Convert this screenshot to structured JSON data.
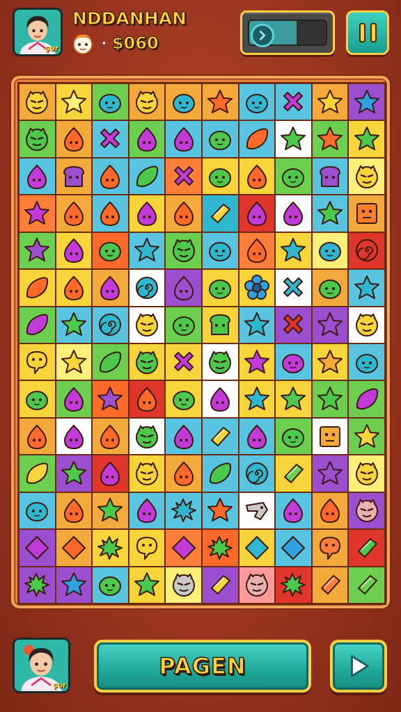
{
  "header": {
    "player_name": "NDDANHAN",
    "coins": "$060",
    "separator": "·",
    "avatar_tag": "ʂᴜr",
    "progress": 0.62
  },
  "footer": {
    "main_button_label": "PAGEN",
    "avatar_tag": "ʂᴜr"
  },
  "board": {
    "rows": [
      [
        [
          "face",
          "#f6d43a",
          "#f4a93b"
        ],
        [
          "star",
          "#fff07a",
          "#f6d43a"
        ],
        [
          "blob",
          "#2fb7d0",
          "#6ccf4f"
        ],
        [
          "face",
          "#f6d43a",
          "#f4a93b"
        ],
        [
          "blob",
          "#2fb7d0",
          "#f4a93b"
        ],
        [
          "star",
          "#ff6a2a",
          "#f4a93b"
        ],
        [
          "blob",
          "#2fb7d0",
          "#58c4e0"
        ],
        [
          "cross",
          "#c23bd8",
          "#58c4e0"
        ],
        [
          "star",
          "#f6d43a",
          "#f4a93b"
        ],
        [
          "star",
          "#2fa0e0",
          "#9b4fcf"
        ]
      ],
      [
        [
          "face",
          "#4cc94c",
          "#6ccf4f"
        ],
        [
          "drop",
          "#ff6a2a",
          "#f4a93b"
        ],
        [
          "cross",
          "#c23bd8",
          "#58c4e0"
        ],
        [
          "drop",
          "#c23bd8",
          "#6ccf4f"
        ],
        [
          "drop",
          "#c23bd8",
          "#58c4e0"
        ],
        [
          "blob",
          "#4cc94c",
          "#58c4e0"
        ],
        [
          "leaf",
          "#ff6a2a",
          "#58c4e0"
        ],
        [
          "star",
          "#4cc94c",
          "#ffffff"
        ],
        [
          "star",
          "#ff6a2a",
          "#6ccf4f"
        ],
        [
          "star",
          "#4cc94c",
          "#f6d43a"
        ]
      ],
      [
        [
          "drop",
          "#c23bd8",
          "#58c4e0"
        ],
        [
          "bread",
          "#9b4fcf",
          "#f4a93b"
        ],
        [
          "drop",
          "#ff6a2a",
          "#58c4e0"
        ],
        [
          "leaf",
          "#4cc94c",
          "#58c4e0"
        ],
        [
          "cross",
          "#c23bd8",
          "#ff7e3a"
        ],
        [
          "blob",
          "#4cc94c",
          "#f6d43a"
        ],
        [
          "drop",
          "#ff6a2a",
          "#f6d43a"
        ],
        [
          "blob",
          "#4cc94c",
          "#6ccf4f"
        ],
        [
          "bread",
          "#9b4fcf",
          "#58c4e0"
        ],
        [
          "face",
          "#f6d43a",
          "#fff07a"
        ]
      ],
      [
        [
          "star",
          "#c23bd8",
          "#ff7e3a"
        ],
        [
          "drop",
          "#ff6a2a",
          "#f4a93b"
        ],
        [
          "drop",
          "#ff6a2a",
          "#58c4e0"
        ],
        [
          "drop",
          "#c23bd8",
          "#f6d43a"
        ],
        [
          "drop",
          "#ff6a2a",
          "#f4a93b"
        ],
        [
          "gem",
          "#f6d43a",
          "#2fb7d0"
        ],
        [
          "drop",
          "#c23bd8",
          "#e0352a"
        ],
        [
          "drop",
          "#c23bd8",
          "#ffffff"
        ],
        [
          "star",
          "#4cc94c",
          "#58c4e0"
        ],
        [
          "box",
          "#ff7e2a",
          "#f4a93b"
        ]
      ],
      [
        [
          "star",
          "#9b4fcf",
          "#6ccf4f"
        ],
        [
          "drop",
          "#c23bd8",
          "#f6d43a"
        ],
        [
          "blob",
          "#4cc94c",
          "#ff6a2a"
        ],
        [
          "star",
          "#2fb7d0",
          "#58c4e0"
        ],
        [
          "face",
          "#4cc94c",
          "#6ccf4f"
        ],
        [
          "blob",
          "#2fb7d0",
          "#58c4e0"
        ],
        [
          "drop",
          "#ff6a2a",
          "#ff7e3a"
        ],
        [
          "star",
          "#2fb7d0",
          "#f6d43a"
        ],
        [
          "blob",
          "#2fb7d0",
          "#fff07a"
        ],
        [
          "swirl",
          "#e0352a",
          "#e0352a"
        ]
      ],
      [
        [
          "leaf",
          "#ff6a2a",
          "#f6d43a"
        ],
        [
          "drop",
          "#ff6a2a",
          "#f6d43a"
        ],
        [
          "drop",
          "#c23bd8",
          "#f4a93b"
        ],
        [
          "swirl",
          "#2fb7d0",
          "#ffffff"
        ],
        [
          "drop",
          "#9b4fcf",
          "#9b4fcf"
        ],
        [
          "blob",
          "#4cc94c",
          "#f6d43a"
        ],
        [
          "flower",
          "#2fa0e0",
          "#f6d43a"
        ],
        [
          "cross",
          "#2fb7d0",
          "#ffffff"
        ],
        [
          "blob",
          "#4cc94c",
          "#f4a93b"
        ],
        [
          "star",
          "#2fb7d0",
          "#58c4e0"
        ]
      ],
      [
        [
          "leaf",
          "#c23bd8",
          "#6ccf4f"
        ],
        [
          "star",
          "#4cc94c",
          "#58c4e0"
        ],
        [
          "swirl",
          "#2fb7d0",
          "#58c4e0"
        ],
        [
          "face",
          "#f6d43a",
          "#ffffff"
        ],
        [
          "blob",
          "#4cc94c",
          "#6ccf4f"
        ],
        [
          "bread",
          "#4cc94c",
          "#f6d43a"
        ],
        [
          "star",
          "#2fb7d0",
          "#58c4e0"
        ],
        [
          "cross",
          "#e0352a",
          "#9b4fcf"
        ],
        [
          "star",
          "#9b4fcf",
          "#9b4fcf"
        ],
        [
          "face",
          "#f6d43a",
          "#ffffff"
        ]
      ],
      [
        [
          "chat",
          "#f6d43a",
          "#f6d43a"
        ],
        [
          "star",
          "#f6d43a",
          "#fff07a"
        ],
        [
          "leaf",
          "#4cc94c",
          "#6ccf4f"
        ],
        [
          "face",
          "#4cc94c",
          "#f6d43a"
        ],
        [
          "cross",
          "#c23bd8",
          "#f6d43a"
        ],
        [
          "face",
          "#4cc94c",
          "#ffffff"
        ],
        [
          "star",
          "#c23bd8",
          "#f6d43a"
        ],
        [
          "blob",
          "#c23bd8",
          "#58c4e0"
        ],
        [
          "star",
          "#f4a93b",
          "#f6d43a"
        ],
        [
          "blob",
          "#2fb7d0",
          "#58c4e0"
        ]
      ],
      [
        [
          "blob",
          "#4cc94c",
          "#f6d43a"
        ],
        [
          "drop",
          "#c23bd8",
          "#6ccf4f"
        ],
        [
          "star",
          "#9b4fcf",
          "#ff6a2a"
        ],
        [
          "drop",
          "#ff6a2a",
          "#e0352a"
        ],
        [
          "blob",
          "#4cc94c",
          "#f6d43a"
        ],
        [
          "drop",
          "#c23bd8",
          "#ffffff"
        ],
        [
          "star",
          "#2fb7d0",
          "#f6d43a"
        ],
        [
          "star",
          "#4cc94c",
          "#f6d43a"
        ],
        [
          "star",
          "#4cc94c",
          "#6ccf4f"
        ],
        [
          "leaf",
          "#c23bd8",
          "#6ccf4f"
        ]
      ],
      [
        [
          "drop",
          "#ff6a2a",
          "#f4a93b"
        ],
        [
          "drop",
          "#c23bd8",
          "#ffffff"
        ],
        [
          "drop",
          "#ff6a2a",
          "#f4a93b"
        ],
        [
          "face",
          "#4cc94c",
          "#ffffff"
        ],
        [
          "drop",
          "#c23bd8",
          "#58c4e0"
        ],
        [
          "gem",
          "#f6d43a",
          "#58c4e0"
        ],
        [
          "drop",
          "#c23bd8",
          "#58c4e0"
        ],
        [
          "blob",
          "#4cc94c",
          "#6ccf4f"
        ],
        [
          "box",
          "#f4a93b",
          "#ffffff"
        ],
        [
          "star",
          "#f6d43a",
          "#6ccf4f"
        ]
      ],
      [
        [
          "leaf",
          "#f6d43a",
          "#6ccf4f"
        ],
        [
          "star",
          "#4cc94c",
          "#9b4fcf"
        ],
        [
          "drop",
          "#c23bd8",
          "#e0352a"
        ],
        [
          "face",
          "#f6d43a",
          "#f6d43a"
        ],
        [
          "drop",
          "#ff6a2a",
          "#f4a93b"
        ],
        [
          "leaf",
          "#4cc94c",
          "#58c4e0"
        ],
        [
          "swirl",
          "#2fb7d0",
          "#58c4e0"
        ],
        [
          "gem",
          "#6ccf4f",
          "#f6d43a"
        ],
        [
          "star",
          "#9b4fcf",
          "#9b4fcf"
        ],
        [
          "face",
          "#f6d43a",
          "#fff07a"
        ]
      ],
      [
        [
          "blob",
          "#2fb7d0",
          "#58c4e0"
        ],
        [
          "drop",
          "#ff6a2a",
          "#f4a93b"
        ],
        [
          "star",
          "#4cc94c",
          "#f4a93b"
        ],
        [
          "drop",
          "#c23bd8",
          "#58c4e0"
        ],
        [
          "splat",
          "#2fb7d0",
          "#58c4e0"
        ],
        [
          "star",
          "#ff6a2a",
          "#58c4e0"
        ],
        [
          "bird",
          "#c8c8c8",
          "#ffffff"
        ],
        [
          "drop",
          "#c23bd8",
          "#58c4e0"
        ],
        [
          "drop",
          "#ff6a2a",
          "#f4a93b"
        ],
        [
          "face",
          "#e8b0b0",
          "#9b4fcf"
        ]
      ],
      [
        [
          "diamond",
          "#c23bd8",
          "#9b4fcf"
        ],
        [
          "diamond",
          "#ff6a2a",
          "#f4a93b"
        ],
        [
          "splat",
          "#4cc94c",
          "#f6d43a"
        ],
        [
          "chat",
          "#f6d43a",
          "#f6d43a"
        ],
        [
          "diamond",
          "#c23bd8",
          "#ff7e3a"
        ],
        [
          "splat",
          "#4cc94c",
          "#ff6a2a"
        ],
        [
          "diamond",
          "#2fb7d0",
          "#f6d43a"
        ],
        [
          "diamond",
          "#2fa0e0",
          "#58c4e0"
        ],
        [
          "chat",
          "#ff7e3a",
          "#f4a93b"
        ],
        [
          "gem",
          "#4cc94c",
          "#e0352a"
        ]
      ],
      [
        [
          "splat",
          "#4cc94c",
          "#9b4fcf"
        ],
        [
          "star",
          "#2fa0e0",
          "#9b4fcf"
        ],
        [
          "blob",
          "#4cc94c",
          "#58c4e0"
        ],
        [
          "star",
          "#4cc94c",
          "#f6d43a"
        ],
        [
          "face",
          "#c8c8c8",
          "#fff07a"
        ],
        [
          "gem",
          "#f6d43a",
          "#9b4fcf"
        ],
        [
          "face",
          "#e8b0b0",
          "#ff9a9a"
        ],
        [
          "splat",
          "#4cc94c",
          "#e0352a"
        ],
        [
          "gem",
          "#ff7e3a",
          "#f4a93b"
        ],
        [
          "gem",
          "#6ccf4f",
          "#6ccf4f"
        ]
      ]
    ]
  }
}
